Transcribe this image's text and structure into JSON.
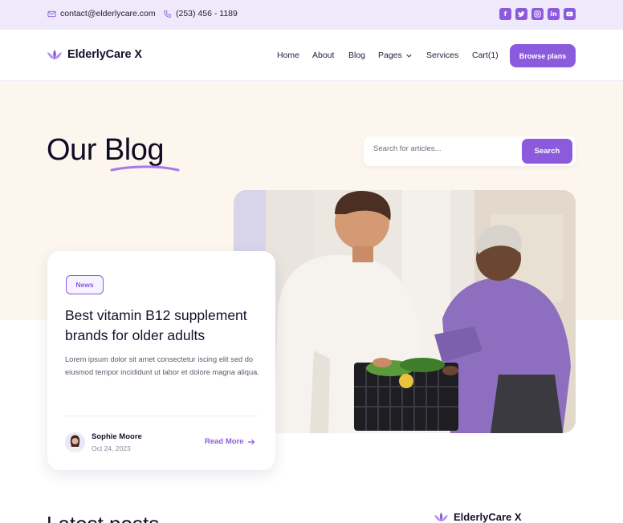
{
  "topbar": {
    "email": "contact@elderlycare.com",
    "phone": "(253) 456 - 1189",
    "socials": [
      "f",
      "t",
      "ig",
      "in",
      "yt"
    ]
  },
  "nav": {
    "brand": "ElderlyCare X",
    "items": [
      "Home",
      "About",
      "Blog",
      "Pages",
      "Services",
      "Cart(1)"
    ],
    "cta": "Browse plans"
  },
  "hero": {
    "title_part1": "Our",
    "title_part2": "Blog",
    "search_placeholder": "Search for articles...",
    "search_button": "Search"
  },
  "featured": {
    "tag": "News",
    "title": "Best vitamin B12 supplement brands for older adults",
    "excerpt": "Lorem ipsum dolor sit amet consectetur iscing elit sed do eiusmod tempor incididunt ut labor  et dolore magna aliqua.",
    "author": "Sophie Moore",
    "date": "Oct 24, 2023",
    "read_more": "Read More"
  },
  "latest": {
    "heading": "Latest posts",
    "brand": "ElderlyCare X"
  },
  "colors": {
    "accent": "#8c5bdd",
    "topbar_bg": "#efe9fb",
    "hero_bg": "#fdf6ef"
  }
}
